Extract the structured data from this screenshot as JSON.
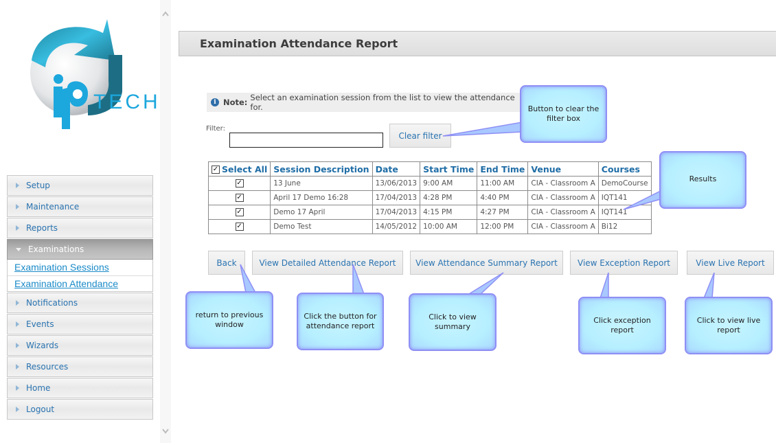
{
  "brand": {
    "logo_text": "TECH",
    "logo_letters": "ip"
  },
  "sidebar": {
    "items": [
      {
        "label": "Setup"
      },
      {
        "label": "Maintenance"
      },
      {
        "label": "Reports"
      },
      {
        "label": "Examinations",
        "expanded": true,
        "children": [
          {
            "label": "Examination Sessions"
          },
          {
            "label": "Examination Attendance"
          }
        ]
      },
      {
        "label": "Notifications"
      },
      {
        "label": "Events"
      },
      {
        "label": "Wizards"
      },
      {
        "label": "Resources"
      },
      {
        "label": "Home"
      },
      {
        "label": "Logout"
      }
    ]
  },
  "page": {
    "title": "Examination Attendance Report",
    "note_label": "Note:",
    "note_text": "Select an examination session from the list to view the attendance for.",
    "filter_label": "Filter:",
    "filter_value": "",
    "clear_filter": "Clear filter"
  },
  "table": {
    "select_all_label": "Select All",
    "select_all_checked": true,
    "columns": [
      "Session Description",
      "Date",
      "Start Time",
      "End Time",
      "Venue",
      "Courses"
    ],
    "rows": [
      {
        "checked": true,
        "cells": [
          "13 June",
          "13/06/2013",
          "9:00 AM",
          "11:00 AM",
          "CIA - Classroom A",
          "DemoCourse"
        ]
      },
      {
        "checked": true,
        "cells": [
          "April 17 Demo 16:28",
          "17/04/2013",
          "4:28 PM",
          "4:40 PM",
          "CIA - Classroom A",
          "IQT141"
        ]
      },
      {
        "checked": true,
        "cells": [
          "Demo 17 April",
          "17/04/2013",
          "4:15 PM",
          "4:27 PM",
          "CIA - Classroom A",
          "IQT141"
        ]
      },
      {
        "checked": true,
        "cells": [
          "Demo Test",
          "14/05/2012",
          "10:00 AM",
          "12:00 PM",
          "CIA - Classroom A",
          "Bi12"
        ]
      }
    ]
  },
  "actions": {
    "back": "Back",
    "detailed": "View Detailed Attendance Report",
    "summary": "View Attendance Summary Report",
    "exception": "View Exception Report",
    "live": "View Live Report"
  },
  "callouts": {
    "clear_filter": "Button to clear the filter box",
    "results": "Results",
    "back": "return to previous window",
    "detailed": "Click the button for attendance report",
    "summary": "Click to view summary",
    "exception": "Click exception report",
    "live": "Click to view live report"
  },
  "icons": {
    "check": "✓",
    "info": "i",
    "scroll_up": "⌃",
    "scroll_down": "⌄"
  },
  "colors": {
    "link": "#1a8ac8",
    "accent": "#2a73b0",
    "callout_fill": "#b6efff",
    "callout_border": "#8f8ff5"
  }
}
